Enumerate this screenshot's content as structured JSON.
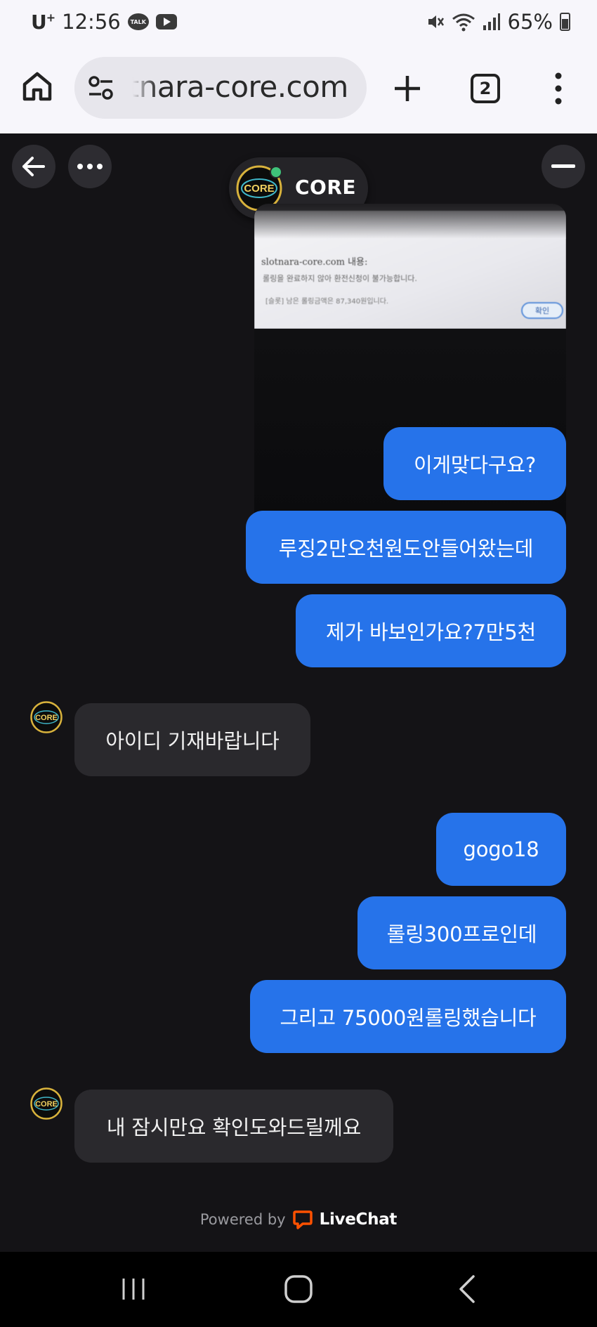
{
  "status_bar": {
    "carrier": "U",
    "carrier_sup": "+",
    "time": "12:56",
    "battery": "65%",
    "icons": [
      "kakaotalk-icon",
      "youtube-icon",
      "mute-icon",
      "wifi-icon",
      "signal-icon",
      "battery-icon"
    ]
  },
  "browser": {
    "url": "slotnara-core.com",
    "tab_count": "2",
    "icons": [
      "home-icon",
      "site-settings-icon",
      "new-tab-icon",
      "tabs-icon",
      "menu-icon"
    ]
  },
  "chat": {
    "agent_name": "CORE",
    "agent_online": true,
    "attachment": {
      "title": "slotnara-core.com 내용:",
      "line1": "롤링을 완료하지 않아 환전신청이 불가능합니다.",
      "line2": "[슬롯] 남은 롤링금액은 87,340원입니다.",
      "button": "확인"
    },
    "messages": [
      {
        "side": "out",
        "text": "이게맞다구요?"
      },
      {
        "side": "out",
        "text": "루징2만오천원도안들어왔는데"
      },
      {
        "side": "out",
        "text": "제가 바보인가요?7만5천"
      },
      {
        "side": "in",
        "text": "아이디 기재바랍니다"
      },
      {
        "side": "out",
        "text": "gogo18"
      },
      {
        "side": "out",
        "text": "롤링300프로인데"
      },
      {
        "side": "out",
        "text": "그리고 75000원롤링했습니다"
      },
      {
        "side": "in",
        "text": "내 잠시만요 확인도와드릴께요"
      }
    ],
    "footer": {
      "powered_by": "Powered by",
      "brand": "LiveChat"
    }
  },
  "colors": {
    "chat_bg": "#141316",
    "outgoing_bubble": "#2673ea",
    "incoming_bubble": "#2a292d",
    "online_dot": "#3fc27a",
    "livechat_orange": "#ff5100"
  }
}
